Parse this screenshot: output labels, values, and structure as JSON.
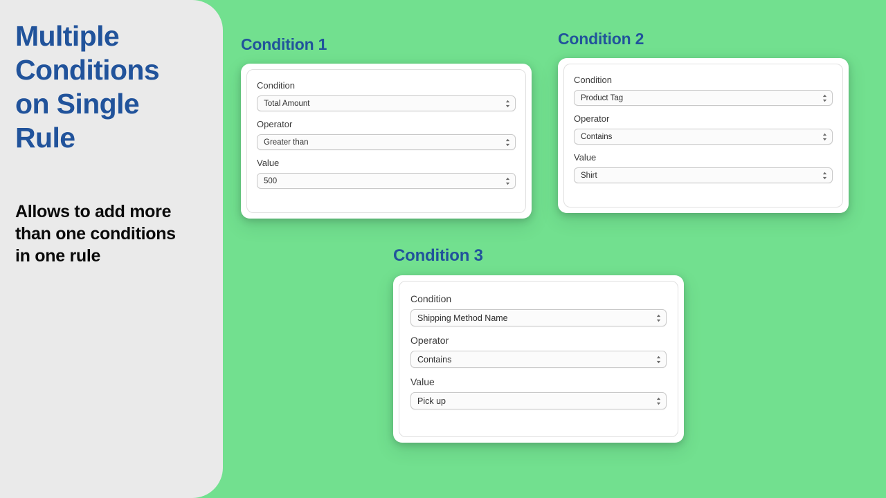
{
  "panel": {
    "title": "Multiple\nConditions\non Single\nRule",
    "subtitle": "Allows to add more\nthan one conditions\nin one rule",
    "title_color": "#21539B",
    "subtitle_color": "#0A0A0A",
    "background_color": "#EAEAEA"
  },
  "stage": {
    "background_color": "#72E08F"
  },
  "field_labels": {
    "condition": "Condition",
    "operator": "Operator",
    "value": "Value"
  },
  "icons": {
    "stepper": "stepper-updown-icon"
  },
  "conditions": [
    {
      "heading": "Condition 1",
      "condition": "Total Amount",
      "operator": "Greater than",
      "value": "500"
    },
    {
      "heading": "Condition 2",
      "condition": "Product Tag",
      "operator": "Contains",
      "value": "Shirt"
    },
    {
      "heading": "Condition 3",
      "condition": "Shipping Method Name",
      "operator": "Contains",
      "value": "Pick up"
    }
  ]
}
